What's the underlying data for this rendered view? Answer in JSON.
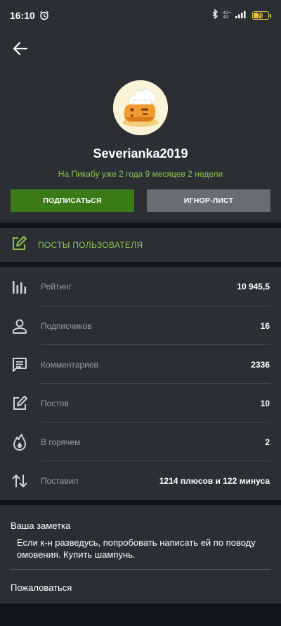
{
  "status_bar": {
    "time": "16:10",
    "network_top": "4G+",
    "network_bottom": "4G",
    "battery": "70",
    "battery_level": 0.7,
    "battery_color": "#e7c24a"
  },
  "profile": {
    "username": "Severianka2019",
    "since": "На Пикабу уже 2 года 9 месяцев 2 недели",
    "subscribe_label": "ПОДПИСАТЬСЯ",
    "ignore_label": "ИГНОР-ЛИСТ"
  },
  "posts_link": {
    "label": "ПОСТЫ ПОЛЬЗОВАТЕЛЯ"
  },
  "stats": [
    {
      "icon": "bar-chart-icon",
      "label": "Рейтинг",
      "value": "10 945,5"
    },
    {
      "icon": "person-icon",
      "label": "Подписчиков",
      "value": "16"
    },
    {
      "icon": "comment-icon",
      "label": "Комментариев",
      "value": "2336"
    },
    {
      "icon": "edit-icon",
      "label": "Постов",
      "value": "10"
    },
    {
      "icon": "flame-icon",
      "label": "В горячем",
      "value": "2"
    },
    {
      "icon": "arrows-updown-icon",
      "label": "Поставил",
      "value": "1214 плюсов и 122 минуса"
    }
  ],
  "note": {
    "title": "Ваша заметка",
    "text": "Если к-н разведусь, попробовать написать ей по поводу омовения. Купить шампунь."
  },
  "complain_label": "Пожаловаться",
  "colors": {
    "accent_green": "#8cc152",
    "button_green": "#3a7a17",
    "button_gray": "#6a6d70",
    "panel": "#2b2f33",
    "background": "#131619"
  }
}
